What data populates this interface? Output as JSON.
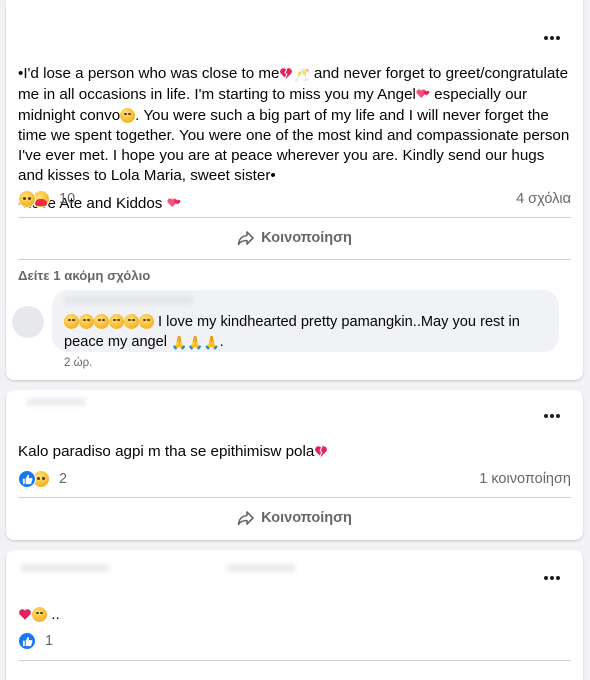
{
  "posts": [
    {
      "text_line1": "•I'd lose a person who was close to me",
      "text_line1b": " and never forget to greet/congratulate me in all occasions in life. I'm starting to miss you my Angel",
      "text_line1c": " especially our midnight convo",
      "text_line1d": ". You were such a big part of my life and I will never forget the time we spent together. You were one of the most kind and compassionate person I've ever met. I hope you are at peace wherever you are. Kindly send our hugs and kisses to Lola Maria, sweet sister•",
      "signature": "-Love Ate and Kiddos ",
      "reaction_count": "10",
      "comments_count": "4 σχόλια",
      "share_label": "Κοινοποίηση",
      "see_more_comments": "Δείτε 1 ακόμη σχόλιο",
      "comment": {
        "text": " I love my kindhearted pretty pamangkin..May you rest in peace my angel ",
        "time": "2 ώρ."
      }
    },
    {
      "text": "Kalo paradiso agpi m tha se epithimisw pola",
      "reaction_count": "2",
      "shares_count": "1 κοινοποίηση",
      "share_label": "Κοινοποίηση"
    },
    {
      "text": " ..",
      "reaction_count": "1"
    }
  ],
  "icons": {
    "more": "more-horizontal-icon",
    "share": "share-arrow-icon",
    "like": "like-reaction-icon",
    "sad": "sad-reaction-icon",
    "care": "care-reaction-icon",
    "love": "love-reaction-icon"
  },
  "colors": {
    "like": "#1877f2",
    "love": "#f33e58",
    "secondary_text": "#65676b",
    "background": "#f0f2f5"
  }
}
